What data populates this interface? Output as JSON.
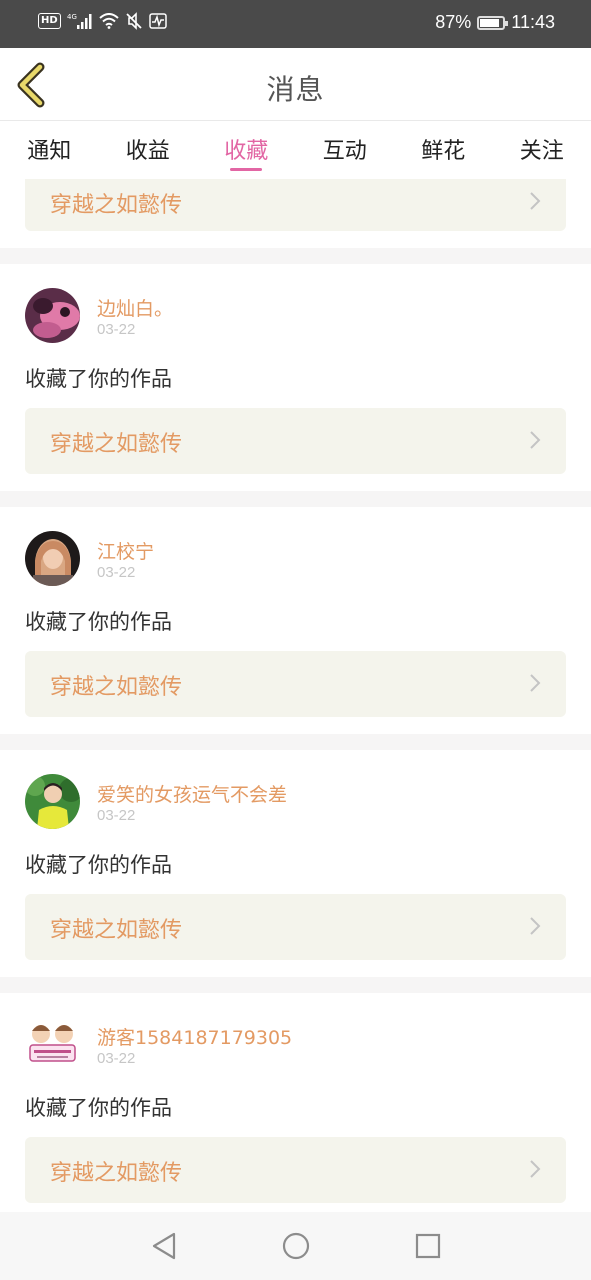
{
  "status_bar": {
    "network": "4G",
    "hd_label": "HD",
    "battery_percent": "87%",
    "battery_level": 0.87,
    "time": "11:43",
    "icons": [
      "hd-icon",
      "signal-icon",
      "wifi-icon",
      "mute-icon",
      "activity-icon",
      "battery-icon"
    ]
  },
  "header": {
    "title": "消息",
    "back_icon": "chevron-left-icon"
  },
  "tabs": [
    {
      "label": "通知",
      "active": false
    },
    {
      "label": "收益",
      "active": false
    },
    {
      "label": "收藏",
      "active": true
    },
    {
      "label": "互动",
      "active": false
    },
    {
      "label": "鲜花",
      "active": false
    },
    {
      "label": "关注",
      "active": false
    }
  ],
  "top_partial": {
    "work_title": "穿越之如懿传"
  },
  "messages": [
    {
      "username": "边灿白。",
      "date": "03-22",
      "action": "收藏了你的作品",
      "work_title": "穿越之如懿传"
    },
    {
      "username": "江校宁",
      "date": "03-22",
      "action": "收藏了你的作品",
      "work_title": "穿越之如懿传"
    },
    {
      "username": "爱笑的女孩运气不会差",
      "date": "03-22",
      "action": "收藏了你的作品",
      "work_title": "穿越之如懿传"
    },
    {
      "username": "游客1584187179305",
      "date": "03-22",
      "action": "收藏了你的作品",
      "work_title": "穿越之如懿传"
    }
  ],
  "colors": {
    "accent": "#e266a4",
    "name": "#e39a63",
    "work_box_bg": "#f4f4ec",
    "status_bar_bg": "#4a4a4a"
  },
  "bottom_nav": [
    "back-triangle-icon",
    "home-circle-icon",
    "recents-square-icon"
  ]
}
